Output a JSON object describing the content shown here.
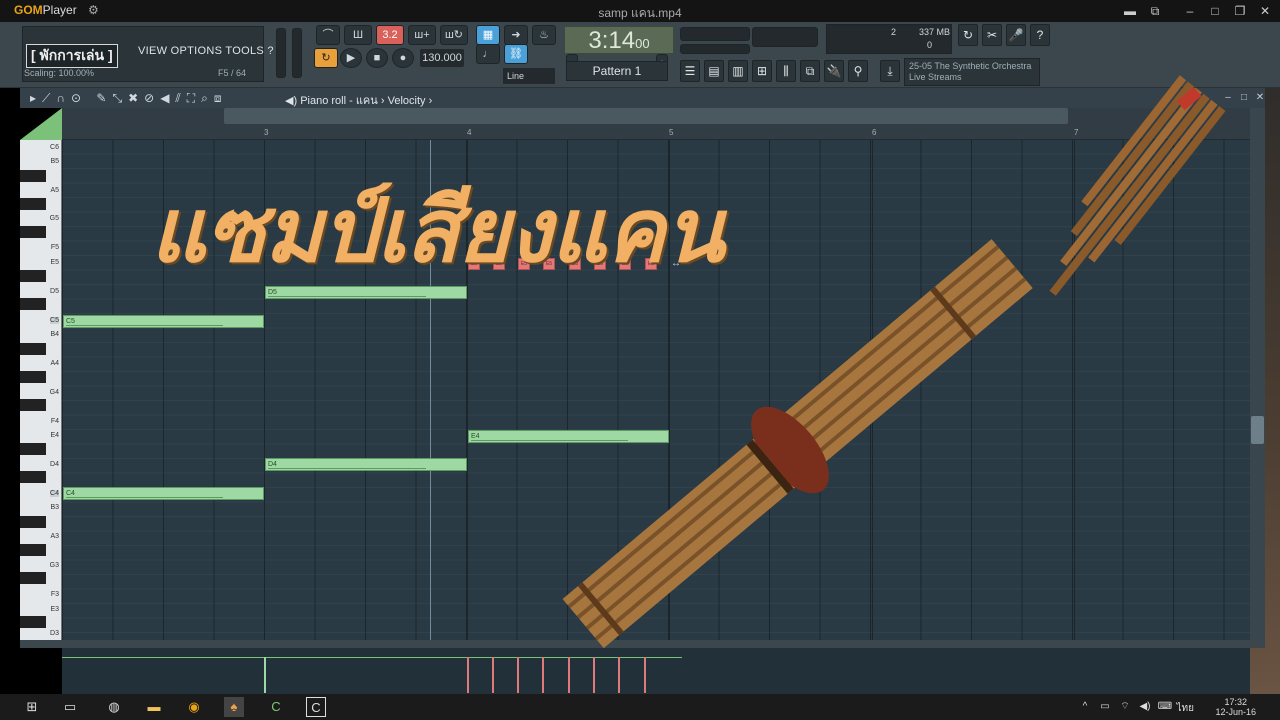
{
  "gom": {
    "logo": "GOM",
    "logo_suffix": "Player",
    "settings_icon": "gear-icon",
    "filename": "samp แคน.mp4"
  },
  "fl": {
    "overlay_hint": "[ พักการเล่น ]",
    "menu": "VIEW  OPTIONS  TOOLS  ?",
    "scaling": "Scaling: 100.00%",
    "position": "F5 / 64",
    "pattern_label": "3.2",
    "time": "3:14",
    "time_small": "00",
    "tempo": "130.000",
    "snap": "Line",
    "pattern": "Pattern 1",
    "cpu_value": "2",
    "memory": "337 MB",
    "memory_sub": "0",
    "news_line1": "25-05  The Synthetic Orchestra",
    "news_line2": "Live Streams"
  },
  "piano_roll": {
    "title": "Piano roll - แคน",
    "breadcrumb": "Velocity",
    "bars": [
      "3",
      "4",
      "5",
      "6",
      "7"
    ],
    "keys": [
      "C6",
      "B5",
      "A5",
      "G5",
      "F5",
      "E5",
      "D5",
      "C5",
      "B4",
      "A4",
      "G4",
      "F4",
      "E4",
      "D4",
      "C4",
      "B3",
      "A3",
      "G3",
      "F3",
      "E3",
      "D3"
    ],
    "notes": [
      {
        "label": "C5"
      },
      {
        "label": "D5"
      },
      {
        "label": "C4"
      },
      {
        "label": "D4"
      },
      {
        "label": "E4"
      }
    ],
    "ghost_label": "E5"
  },
  "overlay": {
    "title": "แซมป์เสียงแคน"
  },
  "taskbar": {
    "time": "17:32",
    "date": "12-Jun-16",
    "language": "ไทย"
  }
}
